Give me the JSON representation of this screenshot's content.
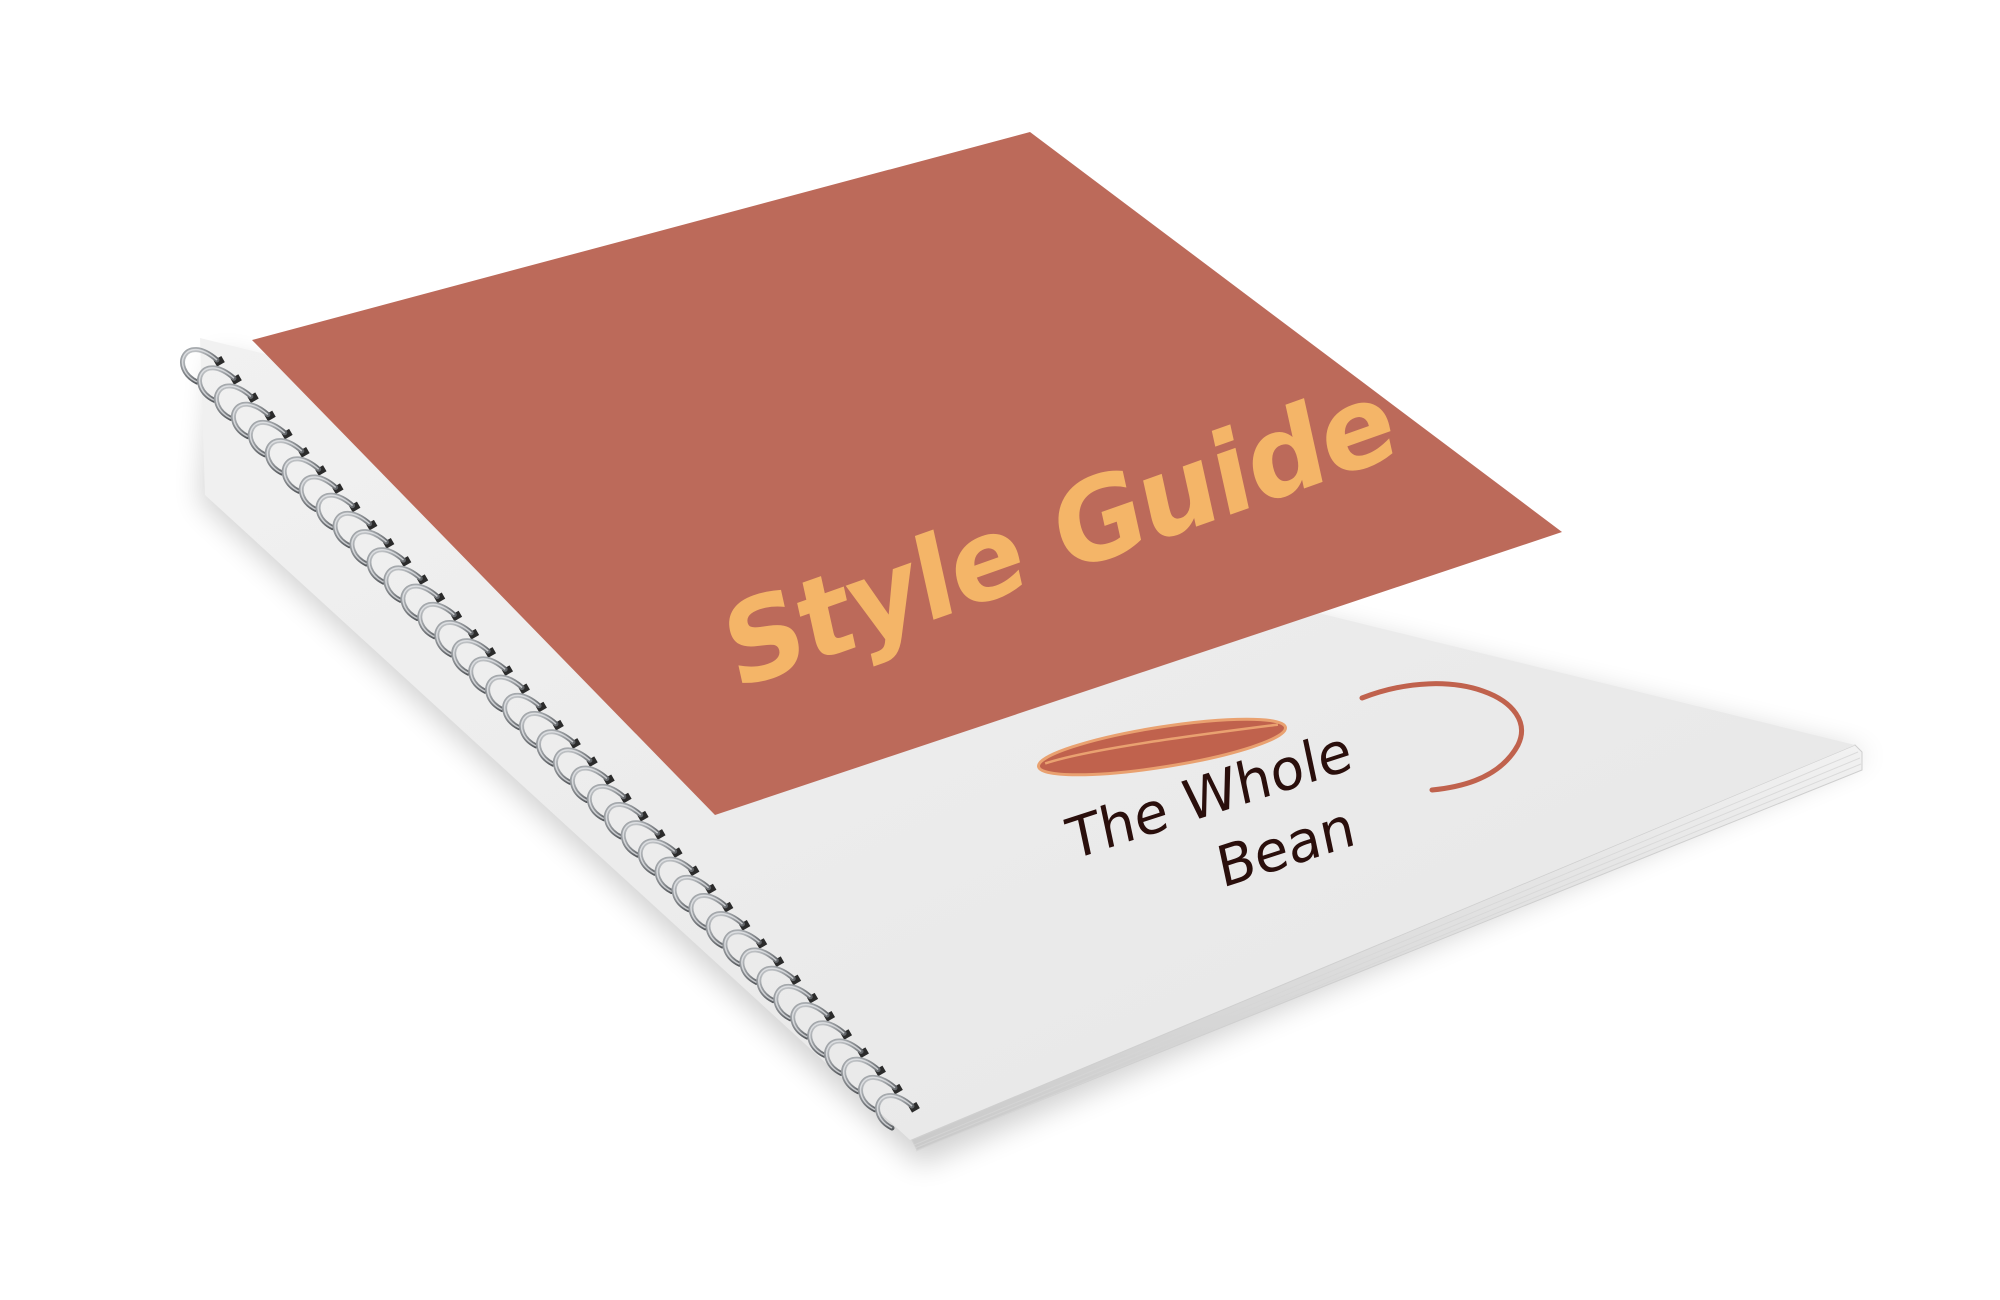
{
  "cover": {
    "title": "Style Guide",
    "brand_line1": "The Whole",
    "brand_line2": "Bean"
  },
  "colors": {
    "background": "#ffffff",
    "cover_top": "#bc6a5a",
    "cover_bottom": "#ececec",
    "title_text": "#f4b568",
    "brand_text": "#2a0f0c",
    "bean_fill": "#c0624d",
    "bean_stroke": "#e9a170",
    "cup_handle": "#c0624d",
    "spiral_wire": "#8a8d91"
  },
  "logo": {
    "name": "the-whole-bean-logo",
    "icon": "coffee-bean-with-cup-handle-icon"
  }
}
